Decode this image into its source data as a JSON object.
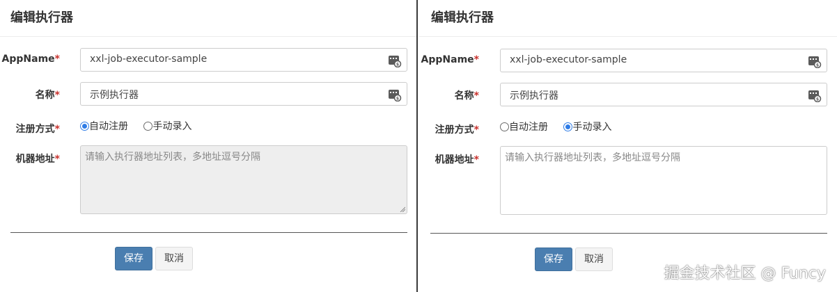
{
  "left": {
    "title": "编辑执行器",
    "appname_label": "AppName",
    "appname_value": "xxl-job-executor-sample",
    "name_label": "名称",
    "name_value": "示例执行器",
    "register_label": "注册方式",
    "register_options": [
      "自动注册",
      "手动录入"
    ],
    "register_selected": "自动注册",
    "address_label": "机器地址",
    "address_placeholder": "请输入执行器地址列表，多地址逗号分隔",
    "address_disabled": true,
    "save_label": "保存",
    "cancel_label": "取消"
  },
  "right": {
    "title": "编辑执行器",
    "appname_label": "AppName",
    "appname_value": "xxl-job-executor-sample",
    "name_label": "名称",
    "name_value": "示例执行器",
    "register_label": "注册方式",
    "register_options": [
      "自动注册",
      "手动录入"
    ],
    "register_selected": "手动录入",
    "address_label": "机器地址",
    "address_placeholder": "请输入执行器地址列表，多地址逗号分隔",
    "address_disabled": false,
    "save_label": "保存",
    "cancel_label": "取消"
  },
  "required_mark": "*",
  "watermark": "掘金技术社区 @ Funcy",
  "colors": {
    "primary_button": "#4a7eb0",
    "required": "#c9302c",
    "radio_selected": "#2f7ce6",
    "disabled_bg": "#eeeeee"
  }
}
